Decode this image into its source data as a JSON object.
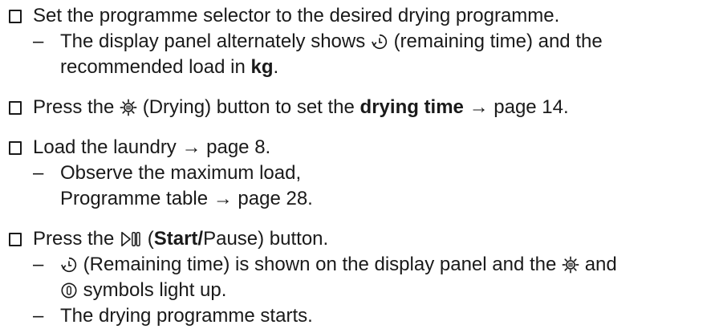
{
  "steps": [
    {
      "main": {
        "t1": "Set the programme selector to the desired drying programme."
      },
      "subs": [
        {
          "dash": "–",
          "a": "The display panel alternately shows",
          "b": "(remaining time) and the",
          "c": "recommended load in",
          "d": "kg",
          "e": "."
        }
      ]
    },
    {
      "main": {
        "t1": "Press the",
        "t2": "(Drying) button to set the",
        "t3": "drying time",
        "t4": "→ page 14."
      }
    },
    {
      "main": {
        "t1": "Load the laundry → page 8."
      },
      "subs": [
        {
          "dash": "–",
          "a": "Observe the maximum load,",
          "b": "Programme table → page 28."
        }
      ]
    },
    {
      "main": {
        "t1": "Press the",
        "t2": "(",
        "t3": "Start/",
        "t4": "Pause) button."
      },
      "subs": [
        {
          "dash": "–",
          "a": "(Remaining time) is shown on the display panel and the",
          "b": "and",
          "c": "symbols light up."
        },
        {
          "dash": "–",
          "a": "The drying programme starts."
        }
      ]
    }
  ],
  "icons": {
    "remaining_time": "remaining-time-icon",
    "drying": "drying-sun-icon",
    "start_pause": "start-pause-icon",
    "door_lock": "door-lock-icon"
  },
  "colors": {
    "text": "#1a1a1a",
    "background": "#ffffff"
  }
}
